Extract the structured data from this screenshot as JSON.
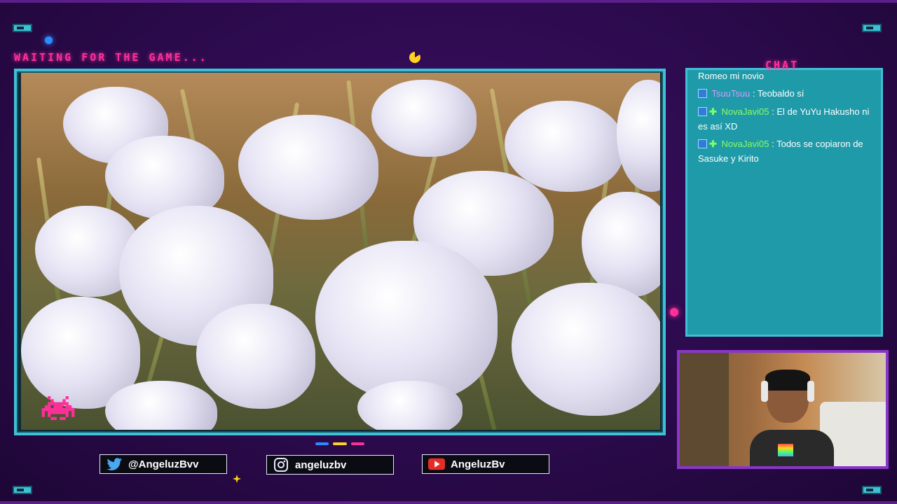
{
  "overlay": {
    "status_text": "WAITING FOR THE GAME...",
    "chat_title": "CHAT"
  },
  "chat": {
    "messages": [
      {
        "user": "",
        "text": "Romeo mi novio"
      },
      {
        "user": "TsuuTsuu",
        "text": ": Teobaldo sí"
      },
      {
        "user": "NovaJavi05",
        "text": ": El de YuYu Hakusho ni es así XD"
      },
      {
        "user": "NovaJavi05",
        "text": ": Todos se copiaron de Sasuke y Kirito"
      }
    ]
  },
  "socials": {
    "twitter": "@AngeluzBvv",
    "instagram": "angeluzbv",
    "youtube": "AngeluzBv"
  },
  "colors": {
    "accent_cyan": "#3fc0d6",
    "accent_pink": "#ff2f9a",
    "background": "#2a0a4a",
    "chat_bg": "#1f9aa8",
    "cam_border": "#8a36c8"
  },
  "icons": [
    "twitter-icon",
    "instagram-icon",
    "youtube-icon",
    "pacman-icon",
    "space-invader-icon"
  ]
}
